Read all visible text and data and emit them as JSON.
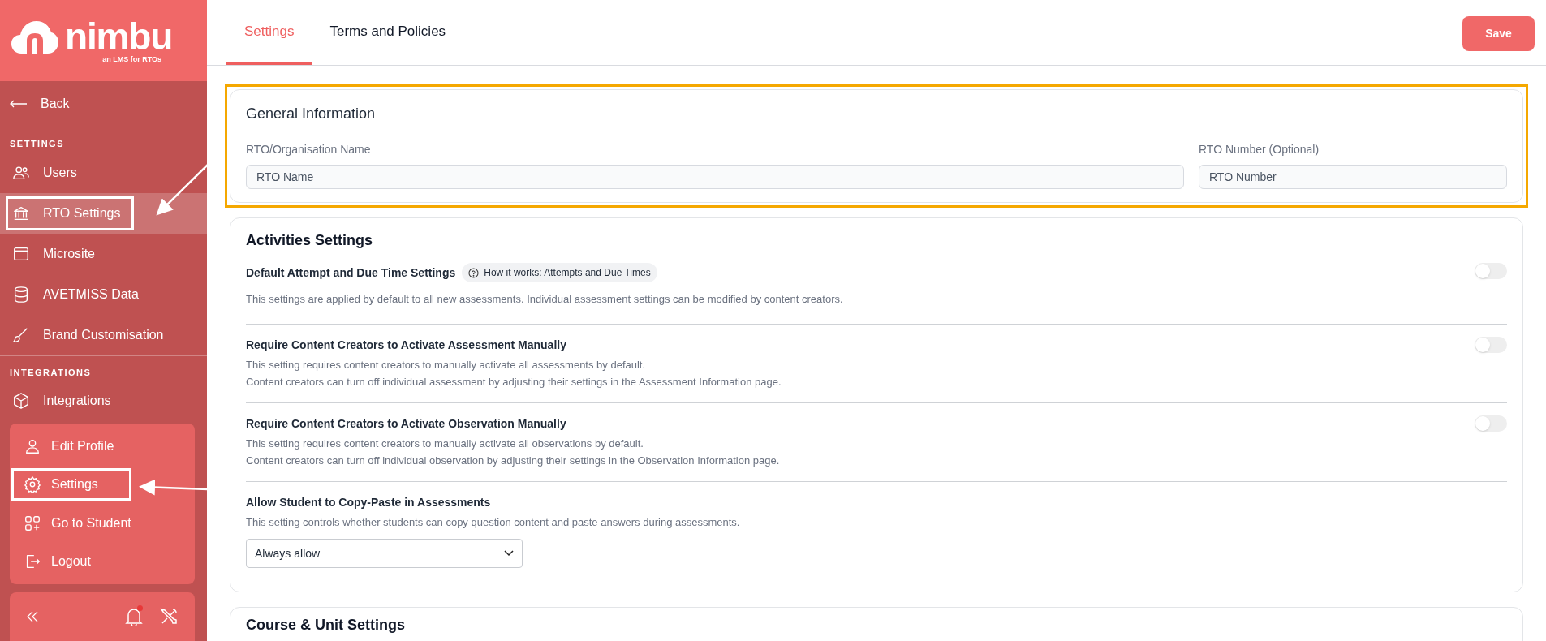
{
  "logo": {
    "wordmark": "nimbu",
    "tagline": "an LMS for RTOs"
  },
  "sidebar": {
    "back": "Back",
    "sections": [
      {
        "heading": "SETTINGS",
        "items": [
          {
            "label": "Users",
            "selected": false,
            "annotated": false
          },
          {
            "label": "RTO Settings",
            "selected": true,
            "annotated": true
          },
          {
            "label": "Microsite",
            "selected": false,
            "annotated": false
          },
          {
            "label": "AVETMISS Data",
            "selected": false,
            "annotated": false
          },
          {
            "label": "Brand Customisation",
            "selected": false,
            "annotated": false
          }
        ]
      },
      {
        "heading": "INTEGRATIONS",
        "items": [
          {
            "label": "Integrations",
            "selected": false,
            "annotated": false
          }
        ]
      }
    ]
  },
  "profile_menu": {
    "items": [
      {
        "label": "Edit Profile",
        "annotated": false
      },
      {
        "label": "Settings",
        "annotated": true
      },
      {
        "label": "Go to Student",
        "annotated": false
      },
      {
        "label": "Logout",
        "annotated": false
      }
    ]
  },
  "bottom_bar": {
    "notification_dot": true
  },
  "tabs": [
    {
      "label": "Settings",
      "selected": true
    },
    {
      "label": "Terms and Policies",
      "selected": false
    }
  ],
  "save_button": "Save",
  "general": {
    "title": "General Information",
    "highlighted": true,
    "fields": [
      {
        "label": "RTO/Organisation Name",
        "placeholder": "RTO Name"
      },
      {
        "label": "RTO Number (Optional)",
        "placeholder": "RTO Number"
      }
    ]
  },
  "activities": {
    "title": "Activities Settings",
    "settings": [
      {
        "kind": "toggle",
        "title": "Default Attempt and Due Time Settings",
        "help_chip": "How it works: Attempts and Due Times",
        "description": [
          "This settings are applied by default to all new assessments. Individual assessment settings can be modified by content creators."
        ],
        "on": false
      },
      {
        "kind": "toggle",
        "title": "Require Content Creators to Activate Assessment Manually",
        "description": [
          "This setting requires content creators to manually activate all assessments by default.",
          "Content creators can turn off individual assessment by adjusting their settings in the Assessment Information page."
        ],
        "on": false
      },
      {
        "kind": "toggle",
        "title": "Require Content Creators to Activate Observation Manually",
        "description": [
          "This setting requires content creators to manually activate all observations by default.",
          "Content creators can turn off individual observation by adjusting their settings in the Observation Information page."
        ],
        "on": false
      },
      {
        "kind": "select",
        "title": "Allow Student to Copy-Paste in Assessments",
        "description": [
          "This setting controls whether students can copy question content and paste answers during assessments."
        ],
        "value": "Always allow"
      }
    ]
  },
  "course": {
    "title": "Course & Unit Settings"
  }
}
